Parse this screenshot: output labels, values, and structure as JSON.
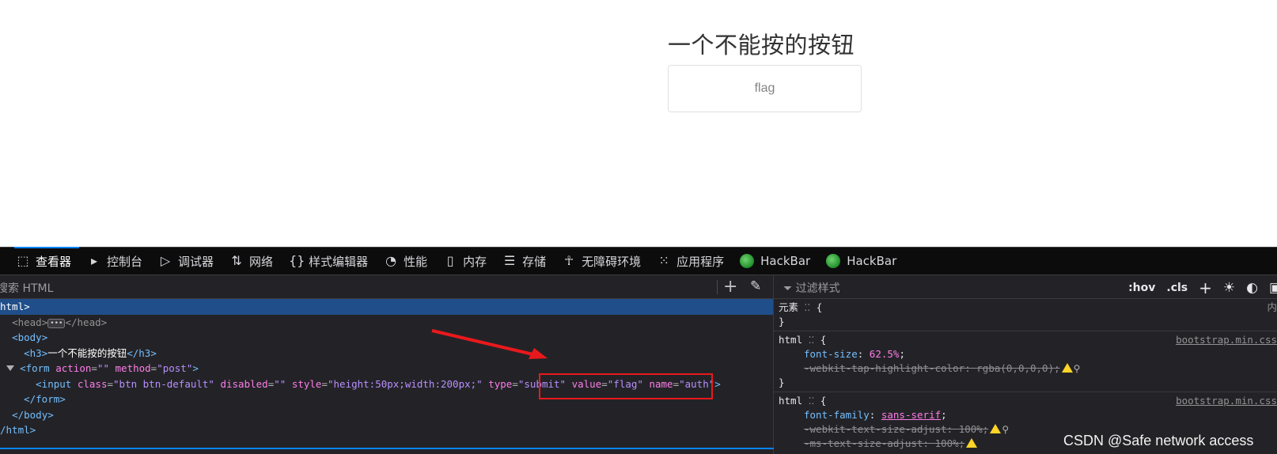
{
  "page": {
    "heading": "一个不能按的按钮",
    "button_value": "flag"
  },
  "devtools": {
    "tabs": [
      {
        "label": "查看器",
        "icon": "inspector-icon"
      },
      {
        "label": "控制台",
        "icon": "console-icon"
      },
      {
        "label": "调试器",
        "icon": "debugger-icon"
      },
      {
        "label": "网络",
        "icon": "network-icon"
      },
      {
        "label": "样式编辑器",
        "icon": "style-editor-icon"
      },
      {
        "label": "性能",
        "icon": "performance-icon"
      },
      {
        "label": "内存",
        "icon": "memory-icon"
      },
      {
        "label": "存储",
        "icon": "storage-icon"
      },
      {
        "label": "无障碍环境",
        "icon": "accessibility-icon"
      },
      {
        "label": "应用程序",
        "icon": "application-icon"
      },
      {
        "label": "HackBar",
        "icon": "hackbar-icon"
      },
      {
        "label": "HackBar",
        "icon": "hackbar-icon"
      }
    ],
    "search_placeholder": "搜索 HTML",
    "filter_placeholder": "过滤样式",
    "style_tools": {
      "hov": ":hov",
      "cls": ".cls"
    },
    "markup": {
      "html_open": "html>",
      "head": "<head>",
      "head_close": "</head>",
      "body_open": "<body>",
      "h3_text": "一个不能按的按钮",
      "h3_open": "<h3>",
      "h3_close": "</h3>",
      "form_open": "<form",
      "form_attr1": "action",
      "form_val1": "\"\"",
      "form_attr2": "method",
      "form_val2": "\"post\"",
      "input_open": "<input",
      "input_attrs": [
        {
          "name": "class",
          "value": "\"btn btn-default\""
        },
        {
          "name": "disabled",
          "value": "\"\""
        },
        {
          "name": "style",
          "value": "\"height:50px;width:200px;\""
        },
        {
          "name": "type",
          "value": "\"submit\""
        },
        {
          "name": "value",
          "value": "\"flag\""
        },
        {
          "name": "name",
          "value": "\"auth\""
        }
      ],
      "form_close": "</form>",
      "body_close": "</body>",
      "html_close": "/html>"
    },
    "rules": [
      {
        "selector": "元素",
        "source": "内",
        "decls": []
      },
      {
        "selector": "html",
        "source": "bootstrap.min.css",
        "decls": [
          {
            "prop": "font-size",
            "value": "62.5%",
            "struck": false
          },
          {
            "prop": "-webkit-tap-highlight-color",
            "value": "rgba(0,0,0,0)",
            "struck": true
          }
        ]
      },
      {
        "selector": "html",
        "source": "bootstrap.min.css",
        "decls": [
          {
            "prop": "font-family",
            "value": "sans-serif",
            "struck": false
          },
          {
            "prop": "-webkit-text-size-adjust",
            "value": "100%",
            "struck": true
          },
          {
            "prop": "-ms-text-size-adjust",
            "value": "100%",
            "struck": true
          }
        ]
      }
    ]
  },
  "watermark": "CSDN @Safe network access",
  "colors": {
    "selection": "#204e8a",
    "annotation_red": "#e8191c",
    "tag_blue": "#75bfff",
    "attr_pink": "#ff7de9",
    "value_purple": "#b98eff"
  }
}
